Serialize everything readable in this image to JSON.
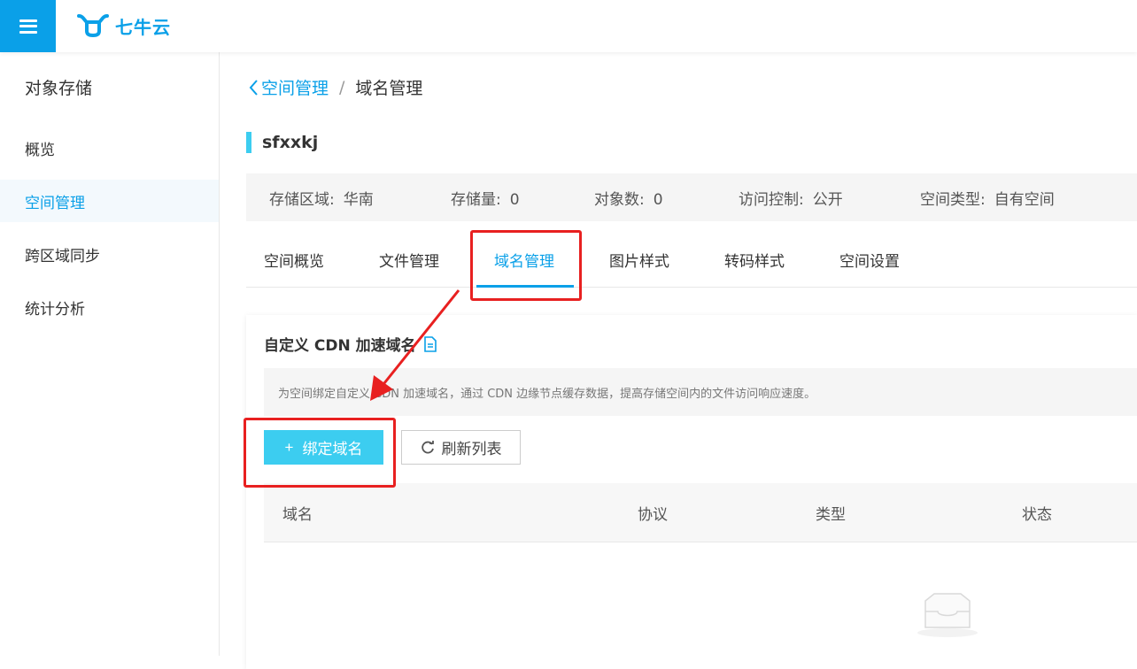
{
  "header": {
    "logo_text": "七牛云"
  },
  "sidebar": {
    "title": "对象存储",
    "items": [
      {
        "label": "概览"
      },
      {
        "label": "空间管理"
      },
      {
        "label": "跨区域同步"
      },
      {
        "label": "统计分析"
      }
    ]
  },
  "breadcrumb": {
    "parent": "空间管理",
    "separator": "/",
    "current": "域名管理"
  },
  "bucket": {
    "name": "sfxxkj"
  },
  "info": [
    {
      "label": "存储区域:",
      "value": "华南"
    },
    {
      "label": "存储量:",
      "value": "0"
    },
    {
      "label": "对象数:",
      "value": "0"
    },
    {
      "label": "访问控制:",
      "value": "公开"
    },
    {
      "label": "空间类型:",
      "value": "自有空间"
    }
  ],
  "tabs": [
    {
      "label": "空间概览"
    },
    {
      "label": "文件管理"
    },
    {
      "label": "域名管理"
    },
    {
      "label": "图片样式"
    },
    {
      "label": "转码样式"
    },
    {
      "label": "空间设置"
    }
  ],
  "card": {
    "title": "自定义 CDN 加速域名",
    "notice": "为空间绑定自定义 CDN 加速域名，通过 CDN 边缘节点缓存数据，提高存储空间内的文件访问响应速度。",
    "bind_button": "绑定域名",
    "refresh_button": "刷新列表",
    "columns": [
      "域名",
      "协议",
      "类型",
      "状态"
    ]
  },
  "colors": {
    "accent": "#0aa0e8",
    "primary_button": "#3ccdf0",
    "annotation": "#e82020"
  }
}
